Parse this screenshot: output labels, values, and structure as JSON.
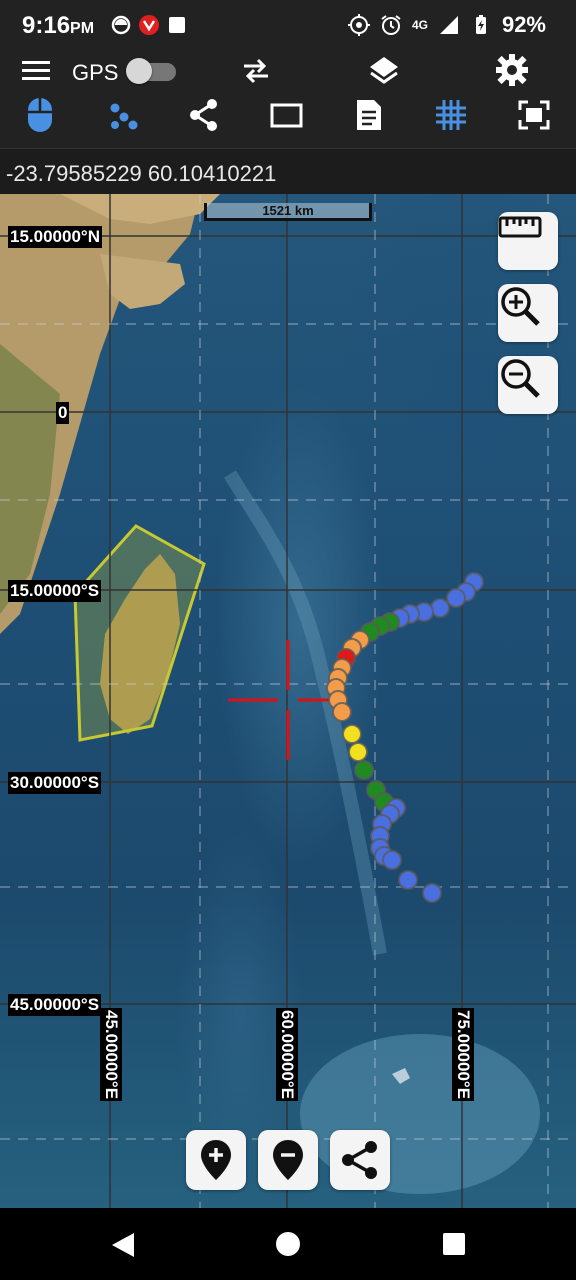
{
  "status": {
    "time": "9:16",
    "ampm": "PM",
    "network": "4G",
    "battery": "92%"
  },
  "toolbar": {
    "gps_label": "GPS",
    "gps_enabled": false,
    "icons": [
      "menu-icon",
      "swap-icon",
      "layers-icon",
      "settings-icon",
      "mouse-icon",
      "points-icon",
      "share-nodes-icon",
      "rectangle-icon",
      "document-icon",
      "grid-icon",
      "fit-screen-icon"
    ],
    "accent": "#4a90e2"
  },
  "coordinates": {
    "text": "-23.79585229 60.10410221"
  },
  "map": {
    "scale_label": "1521 km",
    "lat_labels": [
      "15.00000°N",
      "0",
      "15.00000°S",
      "30.00000°S",
      "45.00000°S"
    ],
    "lon_labels": [
      "45.00000°E",
      "60.00000°E",
      "75.00000°E"
    ],
    "crosshair_color": "#e01010",
    "polygon_color": "#c8c832"
  },
  "track": {
    "colors": {
      "blue": "#4a6fe0",
      "green": "#1f8a1f",
      "orange": "#f39c4a",
      "red": "#e01818",
      "yellow": "#f0e020"
    }
  }
}
